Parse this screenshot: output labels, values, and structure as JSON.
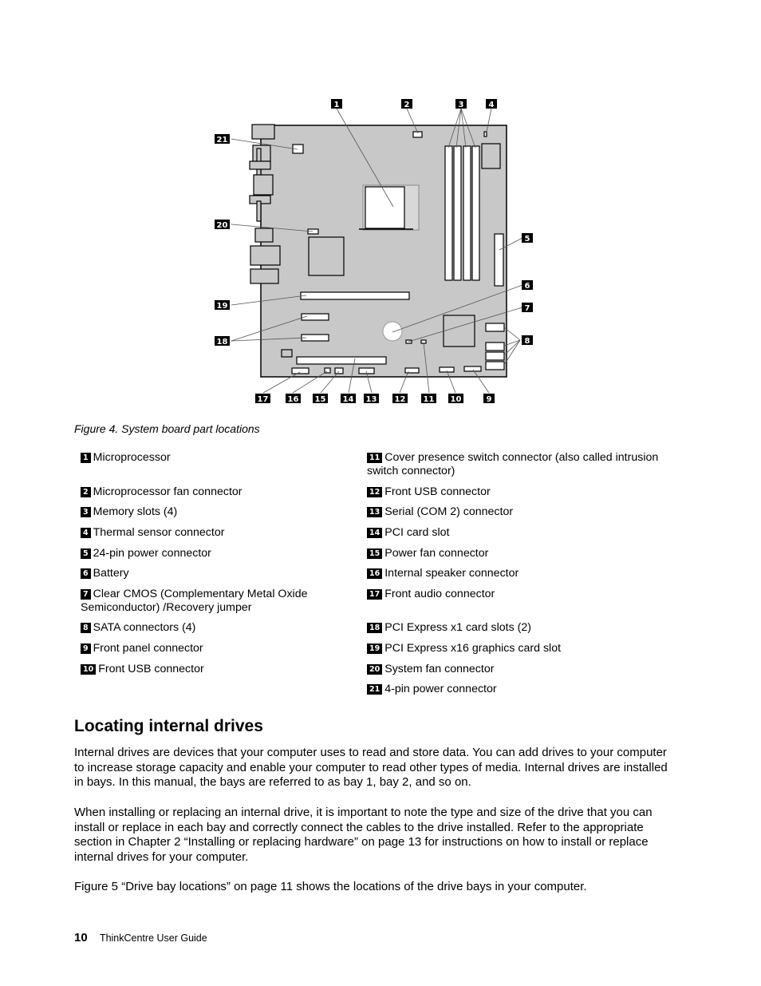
{
  "figure": {
    "caption": "Figure 4.  System board part locations",
    "callouts": [
      "1",
      "2",
      "3",
      "4",
      "5",
      "6",
      "7",
      "8",
      "9",
      "10",
      "11",
      "12",
      "13",
      "14",
      "15",
      "16",
      "17",
      "18",
      "19",
      "20",
      "21"
    ]
  },
  "legend": {
    "left": [
      {
        "num": "1",
        "text": "Microprocessor"
      },
      {
        "num": "2",
        "text": "Microprocessor fan connector"
      },
      {
        "num": "3",
        "text": "Memory slots (4)"
      },
      {
        "num": "4",
        "text": "Thermal sensor connector"
      },
      {
        "num": "5",
        "text": "24-pin power connector"
      },
      {
        "num": "6",
        "text": "Battery"
      },
      {
        "num": "7",
        "text": "Clear CMOS (Complementary Metal Oxide Semiconductor) /Recovery jumper"
      },
      {
        "num": "8",
        "text": "SATA connectors (4)"
      },
      {
        "num": "9",
        "text": "Front panel connector"
      },
      {
        "num": "10",
        "text": "Front USB connector"
      }
    ],
    "right": [
      {
        "num": "11",
        "text": "Cover presence switch connector (also called intrusion switch connector)"
      },
      {
        "num": "12",
        "text": "Front USB connector"
      },
      {
        "num": "13",
        "text": "Serial (COM 2) connector"
      },
      {
        "num": "14",
        "text": "PCI card slot"
      },
      {
        "num": "15",
        "text": "Power fan connector"
      },
      {
        "num": "16",
        "text": "Internal speaker connector"
      },
      {
        "num": "17",
        "text": "Front audio connector"
      },
      {
        "num": "18",
        "text": "PCI Express x1 card slots (2)"
      },
      {
        "num": "19",
        "text": "PCI Express x16 graphics card slot"
      },
      {
        "num": "20",
        "text": "System fan connector"
      },
      {
        "num": "21",
        "text": "4-pin power connector"
      }
    ]
  },
  "section": {
    "title": "Locating internal drives",
    "paragraphs": [
      "Internal drives are devices that your computer uses to read and store data.  You can add drives to your computer to increase storage capacity and enable your computer to read other types of media.  Internal drives are installed in bays.  In this manual, the bays are referred to as bay 1, bay 2, and so on.",
      "When installing or replacing an internal drive, it is important to note the type and size of the drive that you can install or replace in each bay and correctly connect the cables to the drive installed.  Refer to the appropriate section in Chapter 2 “Installing or replacing hardware” on page 13 for instructions on how to install or replace internal drives for your computer.",
      "Figure 5 “Drive bay locations” on page 11 shows the locations of the drive bays in your computer."
    ]
  },
  "footer": {
    "page_number": "10",
    "book_title": "ThinkCentre User Guide"
  }
}
